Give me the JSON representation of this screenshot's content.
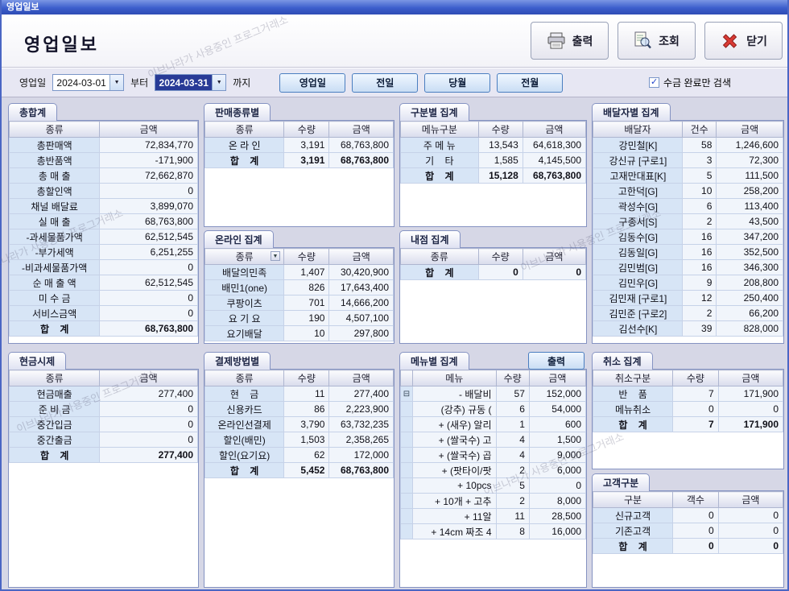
{
  "window": {
    "title": "영업일보"
  },
  "header": {
    "title": "영업일보",
    "print_button": "출력",
    "search_button": "조회",
    "close_button": "닫기"
  },
  "filter": {
    "date_label": "영업일",
    "date_from": "2024-03-01",
    "from_label": "부터",
    "date_to": "2024-03-31",
    "to_label": "까지",
    "range_buttons": [
      "영업일",
      "전일",
      "당월",
      "전월"
    ],
    "checkbox_label": "수금 완료만 검색",
    "checkbox_checked": "✓"
  },
  "watermark": "이브나라가 사용중인 프로그거래소",
  "panels": {
    "total": {
      "title": "총합계",
      "columns": [
        "종류",
        "금액"
      ],
      "rows": [
        {
          "c": [
            "총판매액",
            "72,834,770"
          ]
        },
        {
          "c": [
            "총반품액",
            "-171,900"
          ]
        },
        {
          "c": [
            "총 매 출",
            "72,662,870"
          ]
        },
        {
          "c": [
            "총할인액",
            "0"
          ]
        },
        {
          "c": [
            "채널 배달료",
            "3,899,070"
          ]
        },
        {
          "c": [
            "실 매 출",
            "68,763,800"
          ]
        },
        {
          "c": [
            "-과세물품가액",
            "62,512,545"
          ]
        },
        {
          "c": [
            "-부가세액",
            "6,251,255"
          ]
        },
        {
          "c": [
            "-비과세물품가액",
            "0"
          ]
        },
        {
          "c": [
            "순 매 출 액",
            "62,512,545"
          ]
        },
        {
          "c": [
            "미 수 금",
            "0"
          ]
        },
        {
          "c": [
            "서비스금액",
            "0"
          ]
        },
        {
          "c": [
            "합    계",
            "68,763,800"
          ],
          "bold": true
        }
      ]
    },
    "sales_type": {
      "title": "판매종류별",
      "columns": [
        "종류",
        "수량",
        "금액"
      ],
      "rows": [
        {
          "c": [
            "온 라 인",
            "3,191",
            "68,763,800"
          ]
        },
        {
          "c": [
            "합    계",
            "3,191",
            "68,763,800"
          ],
          "bold": true
        }
      ]
    },
    "online": {
      "title": "온라인 집계",
      "columns": [
        "종류",
        "수량",
        "금액"
      ],
      "rows": [
        {
          "c": [
            "배달의민족",
            "1,407",
            "30,420,900"
          ]
        },
        {
          "c": [
            "배민1(one)",
            "826",
            "17,643,400"
          ]
        },
        {
          "c": [
            "쿠팡이츠",
            "701",
            "14,666,200"
          ]
        },
        {
          "c": [
            "요 기 요",
            "190",
            "4,507,100"
          ]
        },
        {
          "c": [
            "요기배달",
            "10",
            "297,800"
          ]
        }
      ]
    },
    "category": {
      "title": "구분별 집계",
      "columns": [
        "메뉴구분",
        "수량",
        "금액"
      ],
      "rows": [
        {
          "c": [
            "주 메 뉴",
            "13,543",
            "64,618,300"
          ]
        },
        {
          "c": [
            "기    타",
            "1,585",
            "4,145,500"
          ]
        },
        {
          "c": [
            "합    계",
            "15,128",
            "68,763,800"
          ],
          "bold": true
        }
      ]
    },
    "store": {
      "title": "내점 집계",
      "columns": [
        "종류",
        "수량",
        "금액"
      ],
      "rows": [
        {
          "c": [
            "합    계",
            "0",
            "0"
          ],
          "bold": true
        }
      ]
    },
    "deliverer": {
      "title": "배달자별 집계",
      "columns": [
        "배달자",
        "건수",
        "금액"
      ],
      "rows": [
        {
          "c": [
            "강민철[K]",
            "58",
            "1,246,600"
          ]
        },
        {
          "c": [
            "강신규 [구로1]",
            "3",
            "72,300"
          ]
        },
        {
          "c": [
            "고재만대표[K]",
            "5",
            "111,500"
          ]
        },
        {
          "c": [
            "고한덕[G]",
            "10",
            "258,200"
          ]
        },
        {
          "c": [
            "곽성수[G]",
            "6",
            "113,400"
          ]
        },
        {
          "c": [
            "구종서[S]",
            "2",
            "43,500"
          ]
        },
        {
          "c": [
            "김동수[G]",
            "16",
            "347,200"
          ]
        },
        {
          "c": [
            "김동일[G]",
            "16",
            "352,500"
          ]
        },
        {
          "c": [
            "김민범[G]",
            "16",
            "346,300"
          ]
        },
        {
          "c": [
            "김민우[G]",
            "9",
            "208,800"
          ]
        },
        {
          "c": [
            "김민재 [구로1]",
            "12",
            "250,400"
          ]
        },
        {
          "c": [
            "김민준 [구로2]",
            "2",
            "66,200"
          ]
        },
        {
          "c": [
            "김선수[K]",
            "39",
            "828,000"
          ]
        }
      ]
    },
    "cash": {
      "title": "현금시제",
      "columns": [
        "종류",
        "금액"
      ],
      "rows": [
        {
          "c": [
            "현금매출",
            "277,400"
          ]
        },
        {
          "c": [
            "준 비 금",
            "0"
          ]
        },
        {
          "c": [
            "중간입금",
            "0"
          ]
        },
        {
          "c": [
            "중간출금",
            "0"
          ]
        },
        {
          "c": [
            "합    계",
            "277,400"
          ],
          "bold": true
        }
      ]
    },
    "payment": {
      "title": "결제방법별",
      "columns": [
        "종류",
        "수량",
        "금액"
      ],
      "rows": [
        {
          "c": [
            "현    금",
            "11",
            "277,400"
          ]
        },
        {
          "c": [
            "신용카드",
            "86",
            "2,223,900"
          ]
        },
        {
          "c": [
            "온라인선결제",
            "3,790",
            "63,732,235"
          ]
        },
        {
          "c": [
            "할인(배민)",
            "1,503",
            "2,358,265"
          ]
        },
        {
          "c": [
            "할인(요기요)",
            "62",
            "172,000"
          ]
        },
        {
          "c": [
            "합    계",
            "5,452",
            "68,763,800"
          ],
          "bold": true
        }
      ]
    },
    "menu": {
      "title": "메뉴별 집계",
      "print_button": "출력",
      "columns": [
        "",
        "메뉴",
        "수량",
        "금액"
      ],
      "rows": [
        {
          "c": [
            "⊟",
            "- 배달비",
            "57",
            "152,000"
          ]
        },
        {
          "c": [
            "",
            "(강추) 규동 (",
            "6",
            "54,000"
          ]
        },
        {
          "c": [
            "",
            "+ (새우) 알리",
            "1",
            "600"
          ]
        },
        {
          "c": [
            "",
            "+ (쌀국수) 고",
            "4",
            "1,500"
          ]
        },
        {
          "c": [
            "",
            "+ (쌀국수) 곱",
            "4",
            "9,000"
          ]
        },
        {
          "c": [
            "",
            "+ (팟타이/팟",
            "2",
            "6,000"
          ]
        },
        {
          "c": [
            "",
            " + 10pcs",
            "5",
            "0"
          ]
        },
        {
          "c": [
            "",
            "+ 10개 + 고추",
            "2",
            "8,000"
          ]
        },
        {
          "c": [
            "",
            " + 11알",
            "11",
            "28,500"
          ]
        },
        {
          "c": [
            "",
            "+ 14cm 짜조 4",
            "8",
            "16,000"
          ]
        }
      ]
    },
    "cancel": {
      "title": "취소 집계",
      "columns": [
        "취소구분",
        "수량",
        "금액"
      ],
      "rows": [
        {
          "c": [
            "반    품",
            "7",
            "171,900"
          ]
        },
        {
          "c": [
            "메뉴취소",
            "0",
            "0"
          ]
        },
        {
          "c": [
            "합    계",
            "7",
            "171,900"
          ],
          "bold": true
        }
      ]
    },
    "customer": {
      "title": "고객구분",
      "columns": [
        "구분",
        "객수",
        "금액"
      ],
      "rows": [
        {
          "c": [
            "신규고객",
            "0",
            "0"
          ]
        },
        {
          "c": [
            "기존고객",
            "0",
            "0"
          ]
        },
        {
          "c": [
            "합    계",
            "0",
            "0"
          ],
          "bold": true
        }
      ]
    }
  }
}
